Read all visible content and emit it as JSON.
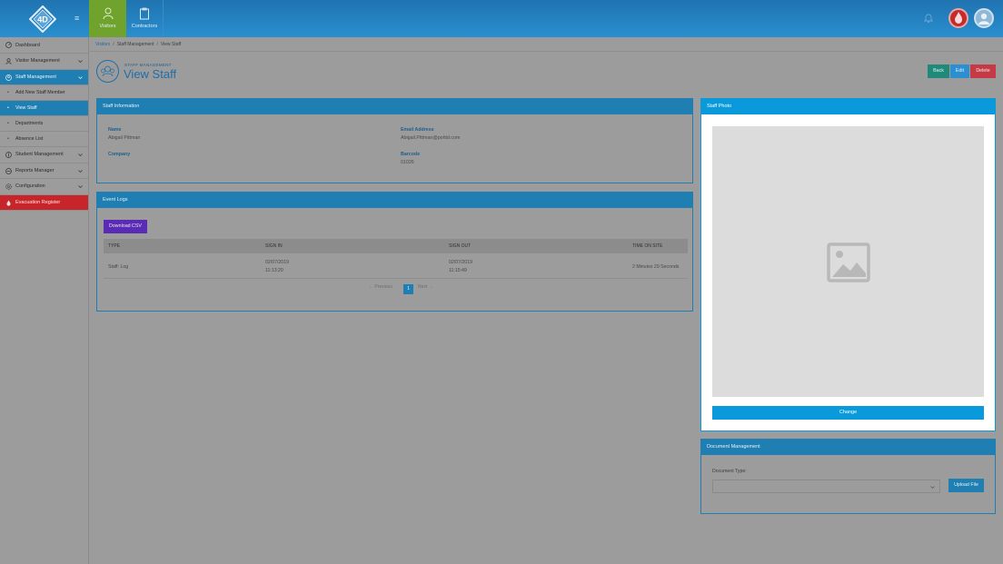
{
  "header": {
    "logo_text": "4D",
    "tabs": [
      {
        "label": "Visitors",
        "active": true
      },
      {
        "label": "Contractors",
        "active": false
      }
    ]
  },
  "sidebar": {
    "items": [
      {
        "label": "Dashboard",
        "icon": "dashboard-icon"
      },
      {
        "label": "Visitor Management",
        "icon": "user-icon",
        "expandable": true
      },
      {
        "label": "Staff Management",
        "icon": "staff-icon",
        "expandable": true,
        "active": true
      },
      {
        "label": "Student Management",
        "icon": "student-icon",
        "expandable": true
      },
      {
        "label": "Reports Manager",
        "icon": "reports-icon",
        "expandable": true
      },
      {
        "label": "Configuration",
        "icon": "gear-icon",
        "expandable": true
      },
      {
        "label": "Evacuation Register",
        "icon": "fire-icon"
      }
    ],
    "staff_sub_items": [
      {
        "label": "Add New Staff Member"
      },
      {
        "label": "View Staff",
        "active": true
      },
      {
        "label": "Departments"
      },
      {
        "label": "Absence List"
      }
    ]
  },
  "breadcrumb": {
    "items": [
      "Visitors",
      "Staff Management",
      "View Staff"
    ],
    "separator": "/"
  },
  "page": {
    "supertitle": "STAFF MANAGEMENT",
    "title": "View Staff",
    "actions": {
      "back": "Back",
      "edit": "Edit",
      "delete": "Delete"
    }
  },
  "staff_info": {
    "heading": "Staff Information",
    "name_label": "Name",
    "name_value": "Abigail Pittman",
    "email_label": "Email Address",
    "email_value": "Abigail.Pittman@pohtd.com",
    "company_label": "Company",
    "company_value": "",
    "barcode_label": "Barcode",
    "barcode_value": "01026"
  },
  "event_logs": {
    "heading": "Event Logs",
    "download_label": "Download CSV",
    "columns": [
      "TYPE",
      "SIGN IN",
      "SIGN OUT",
      "TIME ON SITE"
    ],
    "rows": [
      {
        "type": "Staff: Log",
        "sign_in_date": "02/07/2019",
        "sign_in_time": "11:13:20",
        "sign_out_date": "02/07/2019",
        "sign_out_time": "11:15:49",
        "time_on_site": "2 Minutes 29 Seconds"
      }
    ],
    "pagination": {
      "previous": "← Previous",
      "current": "1",
      "next": "Next →"
    }
  },
  "staff_photo": {
    "heading": "Staff Photo",
    "change_label": "Change"
  },
  "document_management": {
    "heading": "Document Management",
    "type_label": "Document Type:",
    "type_value": "",
    "upload_label": "Upload File"
  },
  "colors": {
    "primary": "#1f7fb3",
    "photo_accent": "#0a9adb",
    "visitors_tab": "#6fa32d",
    "evacuation": "#c8252b",
    "csv_button": "#5a2bb4",
    "back_button": "#1f8a7a",
    "delete_button": "#c63a45"
  }
}
